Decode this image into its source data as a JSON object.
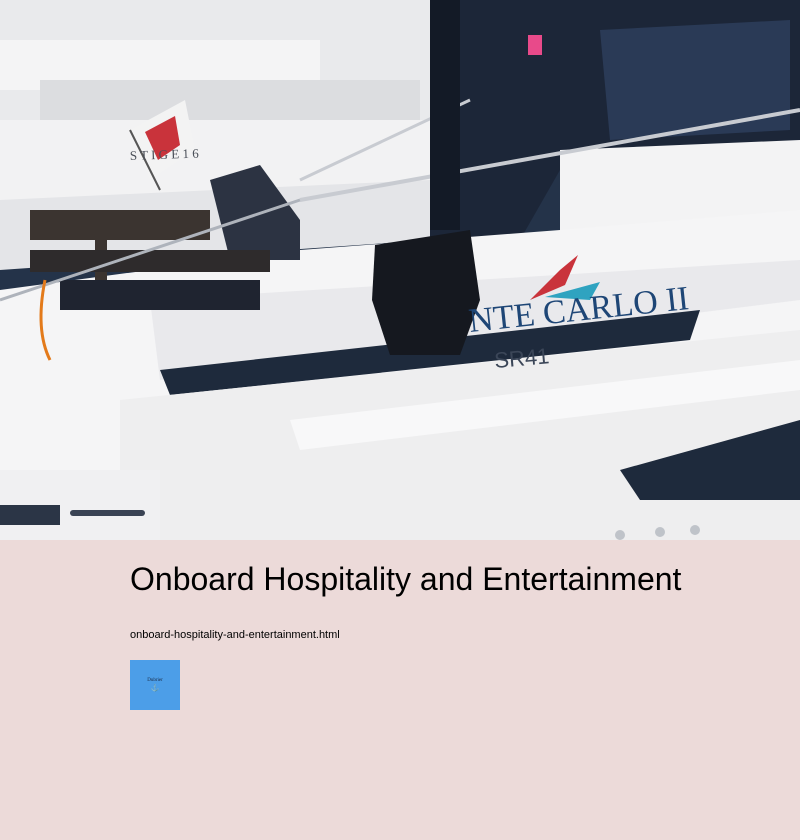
{
  "hero": {
    "image_alt": "White motor yacht docked at a marina",
    "hull_name": "NTE CARLO II",
    "hull_model": "SR41",
    "background_boat_text": "S T I G E   1 6"
  },
  "page": {
    "title": "Onboard Hospitality and Entertainment",
    "link_text": "onboard-hospitality-and-entertainment.html"
  },
  "logo": {
    "text": "Dubrier",
    "icon": "anchor-icon",
    "color": "#4c9ee8"
  }
}
